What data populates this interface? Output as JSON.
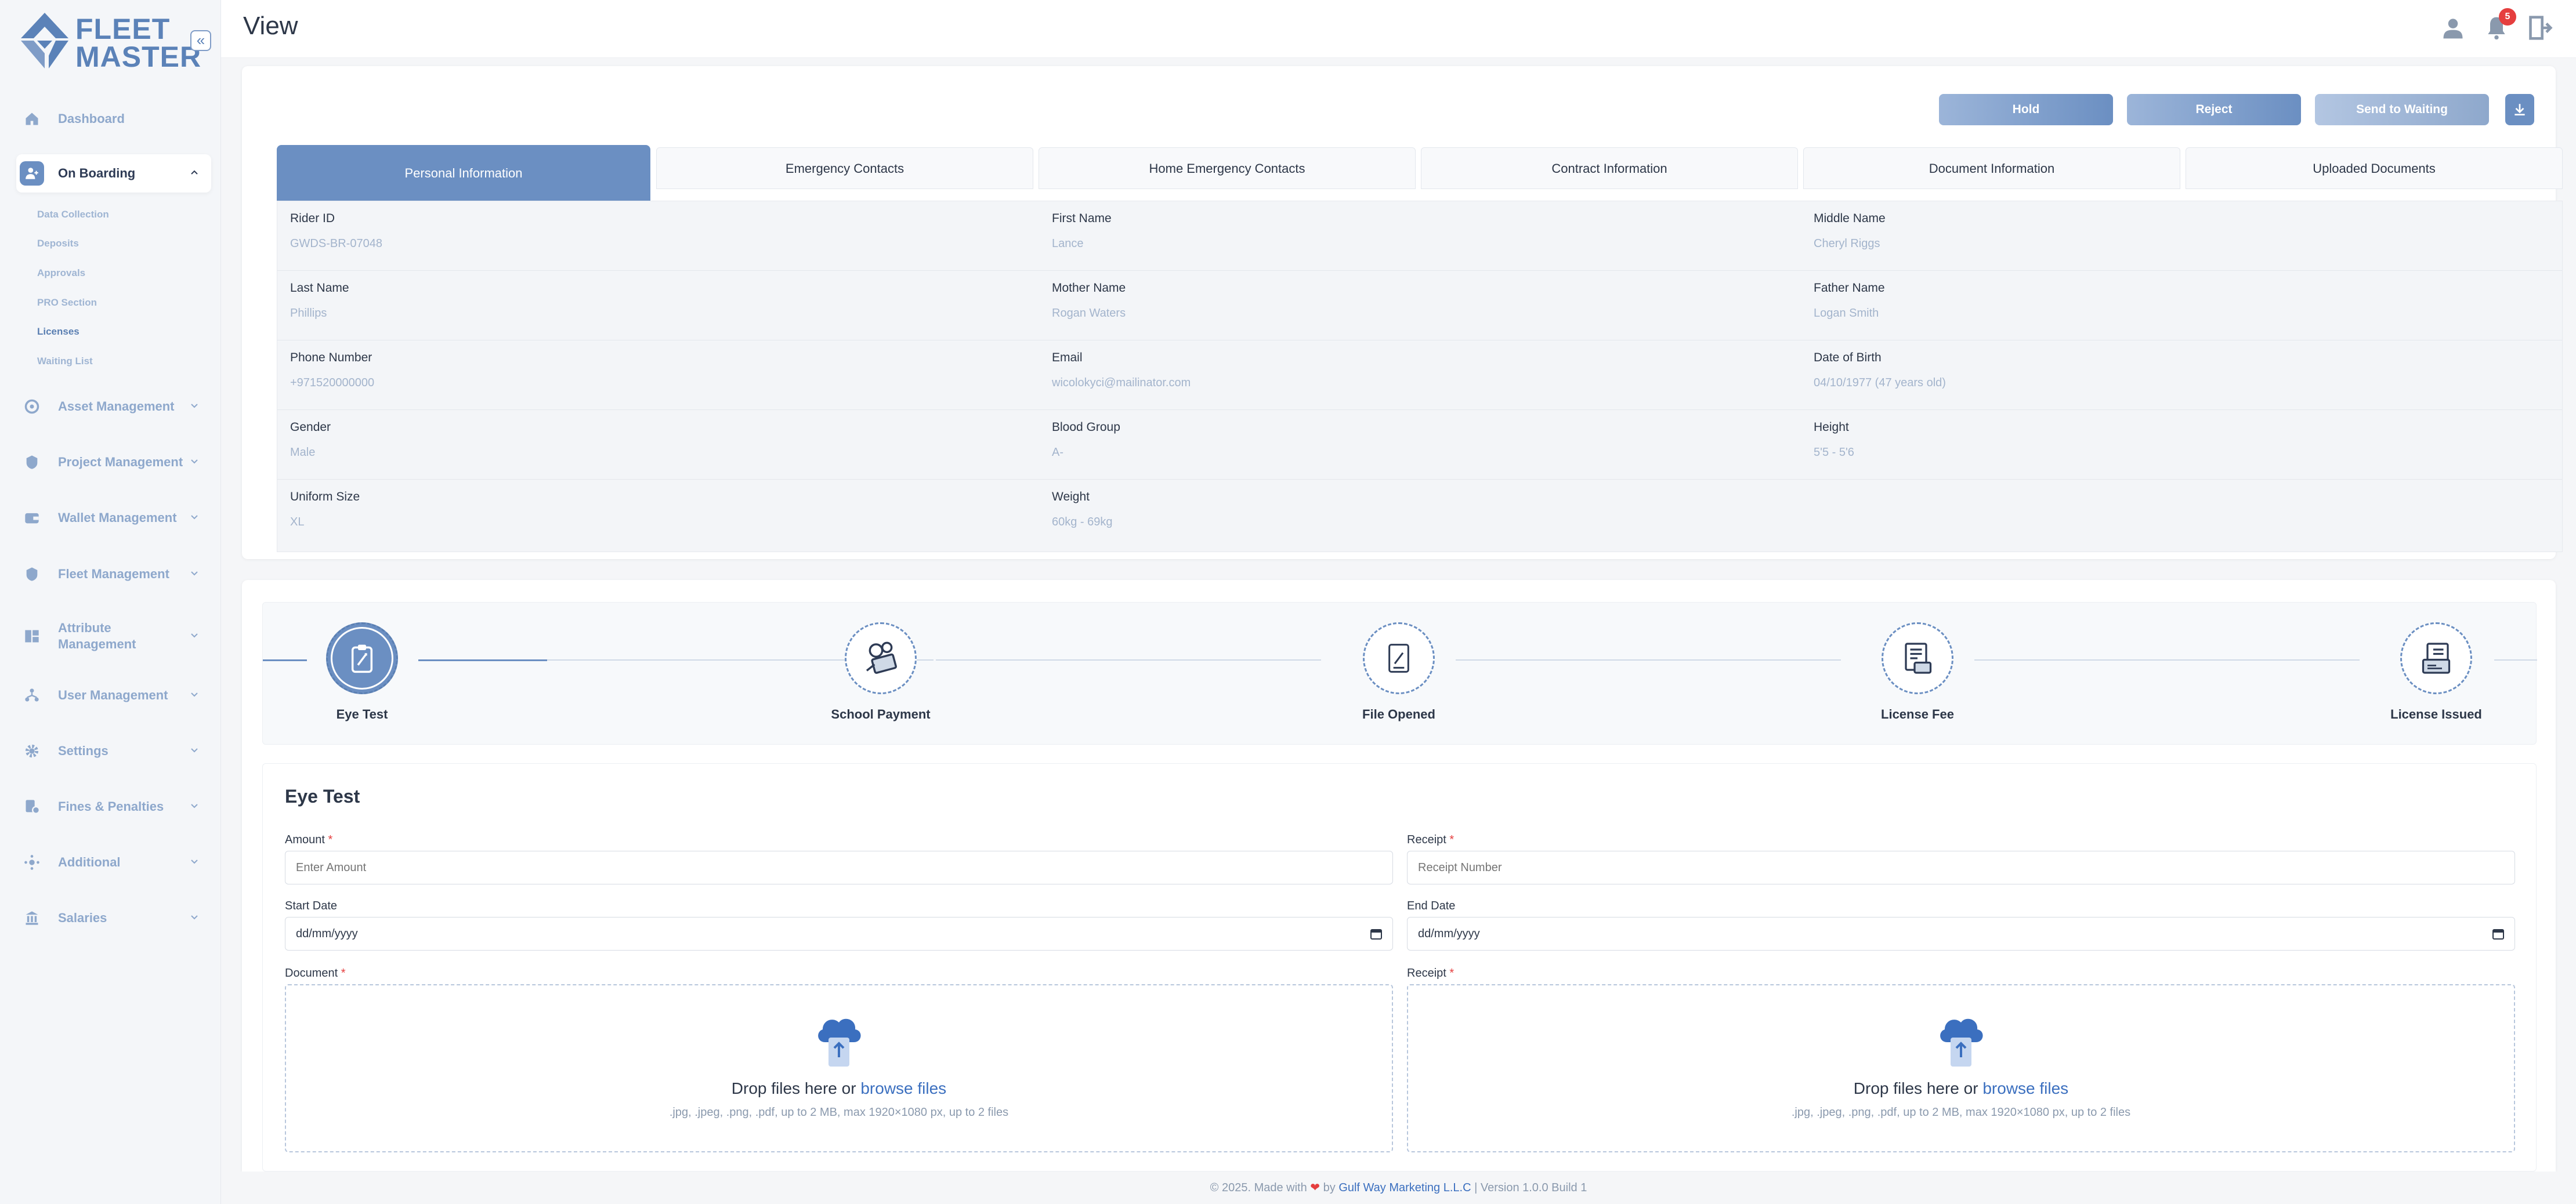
{
  "app": {
    "logo_line1": "FLEET",
    "logo_line2": "MASTER",
    "collapse_icon": "«",
    "accent": "#6b8fc2"
  },
  "sidebar": {
    "items": [
      {
        "label": "Dashboard",
        "icon": "home-icon"
      },
      {
        "label": "On Boarding",
        "icon": "user-plus-icon",
        "active": true
      },
      {
        "label": "Asset Management",
        "icon": "asset-icon"
      },
      {
        "label": "Project Management",
        "icon": "project-icon"
      },
      {
        "label": "Wallet Management",
        "icon": "wallet-icon"
      },
      {
        "label": "Fleet Management",
        "icon": "fleet-icon"
      },
      {
        "label": "Attribute Management",
        "icon": "attribute-icon"
      },
      {
        "label": "User Management",
        "icon": "users-icon"
      },
      {
        "label": "Settings",
        "icon": "gear-icon"
      },
      {
        "label": "Fines & Penalties",
        "icon": "fines-icon"
      },
      {
        "label": "Additional",
        "icon": "additional-icon"
      },
      {
        "label": "Salaries",
        "icon": "salaries-icon"
      }
    ],
    "sub_items": [
      "Data Collection",
      "Deposits",
      "Approvals",
      "PRO Section",
      "Licenses",
      "Waiting List"
    ]
  },
  "header": {
    "title": "View",
    "notification_count": "5"
  },
  "actions": {
    "hold": "Hold",
    "reject": "Reject",
    "send_to_waiting": "Send to Waiting"
  },
  "tabs": [
    "Personal Information",
    "Emergency Contacts",
    "Home Emergency Contacts",
    "Contract Information",
    "Document Information",
    "Uploaded Documents"
  ],
  "personal": {
    "rider_id": {
      "label": "Rider ID",
      "value": "GWDS-BR-07048"
    },
    "first_name": {
      "label": "First Name",
      "value": "Lance"
    },
    "middle_name": {
      "label": "Middle Name",
      "value": "Cheryl Riggs"
    },
    "last_name": {
      "label": "Last Name",
      "value": "Phillips"
    },
    "mother_name": {
      "label": "Mother Name",
      "value": "Rogan Waters"
    },
    "father_name": {
      "label": "Father Name",
      "value": "Logan Smith"
    },
    "phone": {
      "label": "Phone Number",
      "value": "+971520000000"
    },
    "email": {
      "label": "Email",
      "value": "wicolokyci@mailinator.com"
    },
    "dob": {
      "label": "Date of Birth",
      "value": "04/10/1977 (47 years old)"
    },
    "gender": {
      "label": "Gender",
      "value": "Male"
    },
    "blood_group": {
      "label": "Blood Group",
      "value": "A-"
    },
    "height": {
      "label": "Height",
      "value": "5'5 - 5'6"
    },
    "uniform": {
      "label": "Uniform Size",
      "value": "XL"
    },
    "weight": {
      "label": "Weight",
      "value": "60kg - 69kg"
    }
  },
  "steps": [
    {
      "label": "Eye Test",
      "icon": "clipboard-icon",
      "active": true
    },
    {
      "label": "School Payment",
      "icon": "payment-icon"
    },
    {
      "label": "File Opened",
      "icon": "file-edit-icon"
    },
    {
      "label": "License Fee",
      "icon": "invoice-icon"
    },
    {
      "label": "License Issued",
      "icon": "license-icon"
    }
  ],
  "form": {
    "title": "Eye Test",
    "amount_label": "Amount",
    "amount_placeholder": "Enter Amount",
    "receipt_label": "Receipt",
    "receipt_placeholder": "Receipt Number",
    "start_label": "Start Date",
    "end_label": "End Date",
    "date_placeholder": "dd/mm/yyyy",
    "document_label": "Document",
    "receipt_upload_label": "Receipt",
    "required_mark": "*",
    "drop_text": "Drop files here or",
    "browse": "browse files",
    "hint": ".jpg, .jpeg, .png, .pdf, up to 2 MB, max 1920×1080 px, up to 2 files"
  },
  "footer": {
    "prefix": "© 2025. Made with",
    "by": "by",
    "company": "Gulf Way Marketing L.L.C",
    "version": "| Version 1.0.0 Build 1"
  }
}
